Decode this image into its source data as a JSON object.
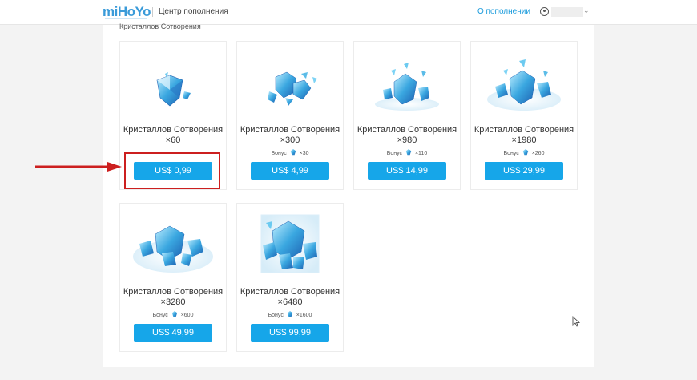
{
  "header": {
    "logo_text": "miHoYo",
    "center_title": "Центр пополнения",
    "about_link": "О пополнении"
  },
  "section_title": "Кристаллов Сотворения",
  "bonus_label": "Бонус",
  "colors": {
    "accent": "#16a6e9",
    "link": "#1a9bdc",
    "highlight": "#cc1f1f"
  },
  "products": [
    {
      "title_line1": "Кристаллов Сотворения",
      "title_line2": "×60",
      "bonus": "",
      "price": "US$ 0,99",
      "icon": "crystal-pack-60-icon"
    },
    {
      "title_line1": "Кристаллов Сотворения",
      "title_line2": "×300",
      "bonus": "×30",
      "price": "US$ 4,99",
      "icon": "crystal-pack-300-icon"
    },
    {
      "title_line1": "Кристаллов Сотворения",
      "title_line2": "×980",
      "bonus": "×110",
      "price": "US$ 14,99",
      "icon": "crystal-pack-980-icon"
    },
    {
      "title_line1": "Кристаллов Сотворения",
      "title_line2": "×1980",
      "bonus": "×260",
      "price": "US$ 29,99",
      "icon": "crystal-pack-1980-icon"
    },
    {
      "title_line1": "Кристаллов Сотворения",
      "title_line2": "×3280",
      "bonus": "×600",
      "price": "US$ 49,99",
      "icon": "crystal-pack-3280-icon"
    },
    {
      "title_line1": "Кристаллов Сотворения",
      "title_line2": "×6480",
      "bonus": "×1600",
      "price": "US$ 99,99",
      "icon": "crystal-pack-6480-icon"
    }
  ]
}
